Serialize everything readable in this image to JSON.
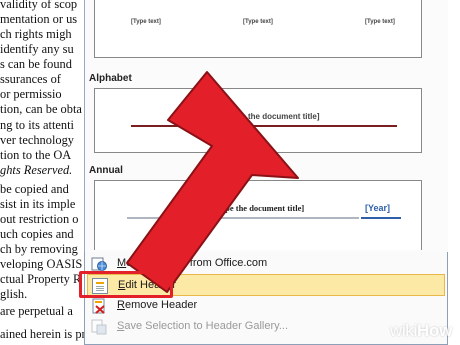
{
  "document": {
    "lines": [
      "validity of scop",
      "mentation or us",
      "ch rights migh",
      "identify any su",
      "s can be found",
      "ssurances of",
      "or permissio",
      "tion, can be obta",
      "",
      "ng to its attenti",
      "ver technology",
      "tion to the OA",
      "ghts Reserved.",
      "",
      "be copied and",
      "sist in its imple",
      "out restriction o",
      "uch copies and",
      "ch by removing",
      "veloping OASIS",
      "ctual Property R",
      "glish.",
      "",
      "are perpetual a",
      "",
      "ained herein is provided on an \"AS IS\" basis and OASIS"
    ]
  },
  "gallery": {
    "type_text_labels": [
      "[Type text]",
      "[Type text]",
      "[Type text]"
    ],
    "categories": [
      {
        "label": "Alphabet",
        "title_text": "[Type the document title]"
      },
      {
        "label": "Annual",
        "title_text": "[Type the document title]",
        "year_text": "[Year]"
      }
    ]
  },
  "menu": {
    "items": [
      {
        "label_prefix": "",
        "label_underlined": "M",
        "label_rest": "ore Headers from Office.com",
        "icon": "globe-icon",
        "state": "normal"
      },
      {
        "label_prefix": "",
        "label_underlined": "E",
        "label_rest": "dit Header",
        "icon": "edit-header-icon",
        "state": "highlighted"
      },
      {
        "label_prefix": "",
        "label_underlined": "R",
        "label_rest": "emove Header",
        "icon": "remove-header-icon",
        "state": "normal"
      },
      {
        "label_prefix": "",
        "label_underlined": "S",
        "label_rest": "ave Selection to Header Gallery...",
        "icon": "save-selection-icon",
        "state": "disabled"
      }
    ]
  },
  "watermark": {
    "wiki": "wiki",
    "how": "How"
  },
  "colors": {
    "highlight": "#fde9a6",
    "highlight_border": "#e9b84a",
    "arrow_fill": "#e3202a",
    "arrow_stroke": "#8a1116",
    "title_rule": "#7a1f1f",
    "year_blue": "#2e5fa8"
  }
}
